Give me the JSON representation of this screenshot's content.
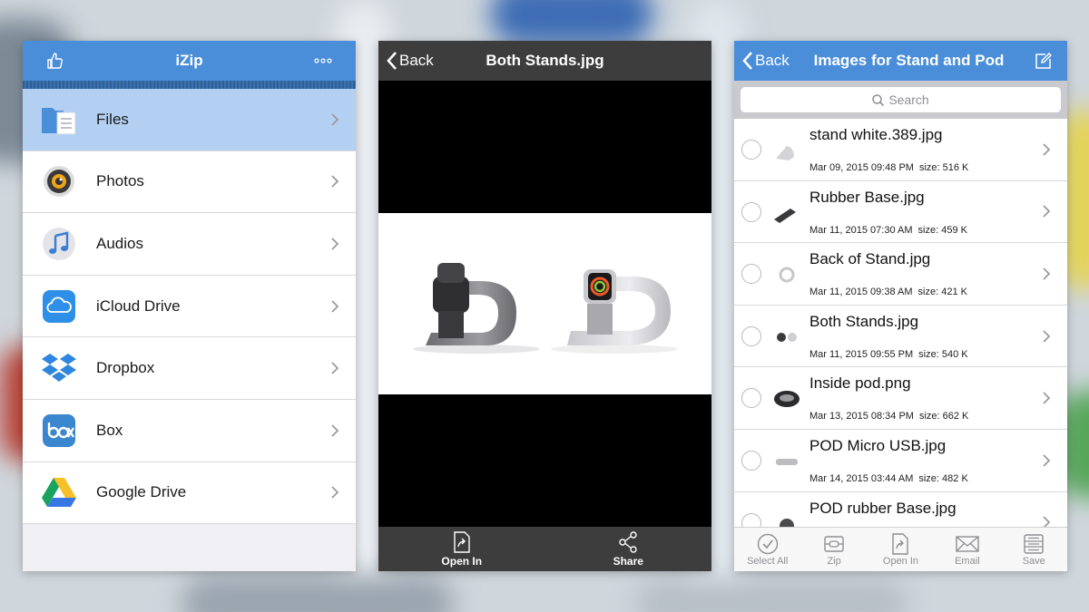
{
  "panel1": {
    "title": "iZip",
    "menu": [
      {
        "label": "Files",
        "icon": "folder-icon",
        "active": true
      },
      {
        "label": "Photos",
        "icon": "photos-icon"
      },
      {
        "label": "Audios",
        "icon": "music-note-icon"
      },
      {
        "label": "iCloud Drive",
        "icon": "icloud-icon"
      },
      {
        "label": "Dropbox",
        "icon": "dropbox-icon"
      },
      {
        "label": "Box",
        "icon": "box-icon"
      },
      {
        "label": "Google Drive",
        "icon": "google-drive-icon"
      }
    ]
  },
  "panel2": {
    "back_label": "Back",
    "title": "Both Stands.jpg",
    "toolbar": {
      "open_in": "Open In",
      "share": "Share"
    }
  },
  "panel3": {
    "back_label": "Back",
    "title": "Images for Stand and Pod",
    "search_placeholder": "Search",
    "files": [
      {
        "name": "stand white.389.jpg",
        "date": "Mar 09, 2015 09:48 PM",
        "size": "size: 516 K"
      },
      {
        "name": "Rubber Base.jpg",
        "date": "Mar 11, 2015 07:30 AM",
        "size": "size: 459 K"
      },
      {
        "name": "Back of Stand.jpg",
        "date": "Mar 11, 2015 09:38 AM",
        "size": "size: 421 K"
      },
      {
        "name": "Both Stands.jpg",
        "date": "Mar 11, 2015 09:55 PM",
        "size": "size: 540 K"
      },
      {
        "name": "Inside pod.png",
        "date": "Mar 13, 2015 08:34 PM",
        "size": "size: 662 K"
      },
      {
        "name": "POD Micro USB.jpg",
        "date": "Mar 14, 2015 03:44 AM",
        "size": "size: 482 K"
      },
      {
        "name": "POD rubber Base.jpg",
        "date": "",
        "size": ""
      }
    ],
    "toolbar": {
      "select_all": "Select All",
      "zip": "Zip",
      "open_in": "Open In",
      "email": "Email",
      "save": "Save"
    }
  },
  "colors": {
    "accent": "#4a8ed9",
    "active_row": "#b3d0f2",
    "dark_bar": "#3d3d3d"
  }
}
